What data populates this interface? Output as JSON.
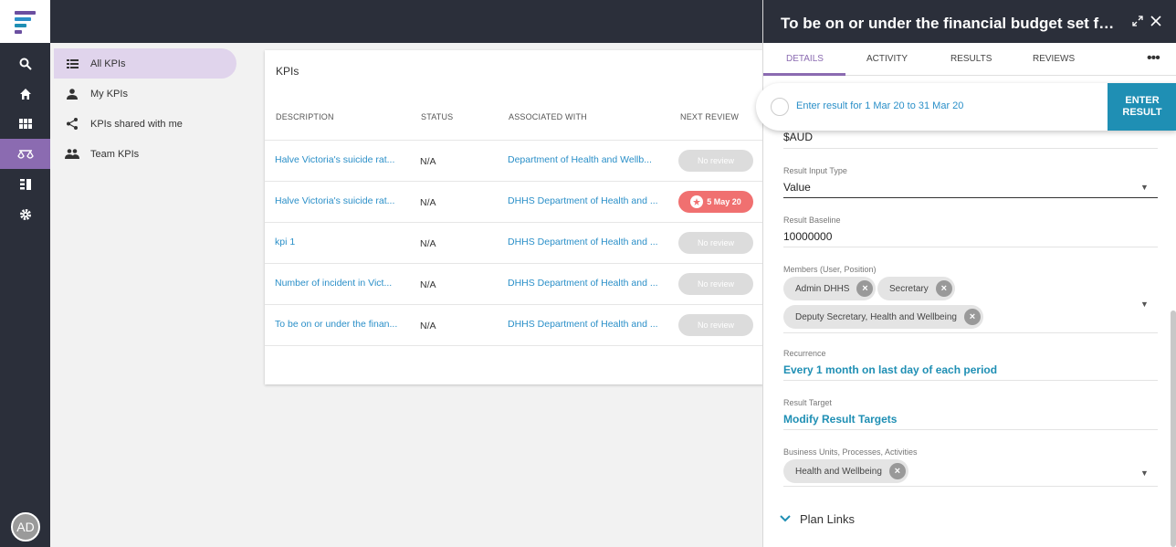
{
  "colors": {
    "rail_bg": "#2b2f3a",
    "accent_purple": "#8b6bb1",
    "link_blue": "#2a8fc8",
    "teal": "#1f8fb4",
    "due_red": "#f07070"
  },
  "rail": {
    "icons": [
      "search-icon",
      "home-icon",
      "grid-icon",
      "scales-icon",
      "list-icon",
      "gear-icon"
    ],
    "avatar_initials": "AD"
  },
  "nav": {
    "items": [
      {
        "label": "All KPIs",
        "icon": "list-icon"
      },
      {
        "label": "My KPIs",
        "icon": "person-icon"
      },
      {
        "label": "KPIs shared with me",
        "icon": "share-icon"
      },
      {
        "label": "Team KPIs",
        "icon": "people-icon"
      }
    ]
  },
  "kpis": {
    "title": "KPIs",
    "headers": {
      "description": "DESCRIPTION",
      "status": "STATUS",
      "associated": "ASSOCIATED WITH",
      "next_review": "NEXT REVIEW"
    },
    "rows": [
      {
        "description": "Halve Victoria's suicide rat...",
        "status": "N/A",
        "associated": "Department of Health and Wellb...",
        "review": "No review"
      },
      {
        "description": "Halve Victoria's suicide rat...",
        "status": "N/A",
        "associated": "DHHS Department of Health and ...",
        "review": "5 May 20"
      },
      {
        "description": "kpi 1",
        "status": "N/A",
        "associated": "DHHS Department of Health and ...",
        "review": "No review"
      },
      {
        "description": "Number of incident in Vict...",
        "status": "N/A",
        "associated": "DHHS Department of Health and ...",
        "review": "No review"
      },
      {
        "description": "To be on or under the finan...",
        "status": "N/A",
        "associated": "DHHS Department of Health and ...",
        "review": "No review"
      }
    ]
  },
  "panel": {
    "title": "To be on or under the financial budget set for th...",
    "tabs": [
      "DETAILS",
      "ACTIVITY",
      "RESULTS",
      "REVIEWS"
    ],
    "more": "•••",
    "banner": {
      "text": "Enter result for 1 Mar 20 to 31 Mar 20",
      "button": "ENTER RESULT"
    },
    "unit_value": "$AUD",
    "result_input_type": {
      "label": "Result Input Type",
      "value": "Value"
    },
    "result_baseline": {
      "label": "Result Baseline",
      "value": "10000000"
    },
    "members": {
      "label": "Members (User, Position)",
      "chips": [
        "Admin DHHS",
        "Secretary",
        "Deputy Secretary, Health and Wellbeing"
      ]
    },
    "recurrence": {
      "label": "Recurrence",
      "value": "Every 1 month on last day of each period"
    },
    "result_target": {
      "label": "Result Target",
      "value": "Modify Result Targets"
    },
    "business_units": {
      "label": "Business Units, Processes, Activities",
      "chips": [
        "Health and Wellbeing"
      ]
    },
    "plan_links": "Plan Links"
  }
}
